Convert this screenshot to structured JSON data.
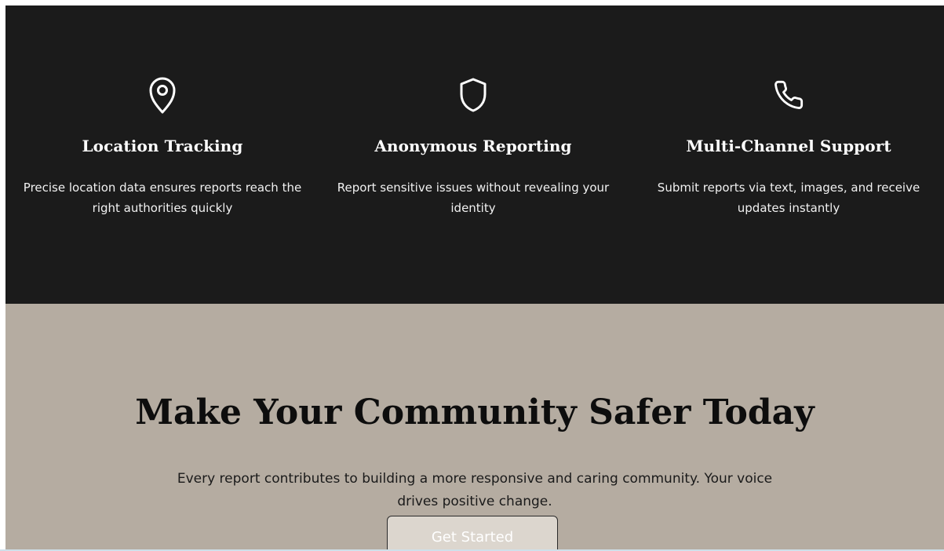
{
  "features": [
    {
      "icon": "location-pin-icon",
      "title": "Location Tracking",
      "description": "Precise location data ensures reports reach the right authorities quickly"
    },
    {
      "icon": "shield-icon",
      "title": "Anonymous Reporting",
      "description": "Report sensitive issues without revealing your identity"
    },
    {
      "icon": "phone-icon",
      "title": "Multi-Channel Support",
      "description": "Submit reports via text, images, and receive updates instantly"
    }
  ],
  "cta": {
    "heading": "Make Your Community Safer Today",
    "subtext": "Every report contributes to building a more responsive and caring community. Your voice drives positive change.",
    "button_label": "Get Started"
  },
  "colors": {
    "features_background": "#1b1b1b",
    "cta_background": "#b5aca1",
    "button_background": "#dcd6ce",
    "text_light": "#ffffff",
    "text_dark": "#0d0d0d"
  }
}
